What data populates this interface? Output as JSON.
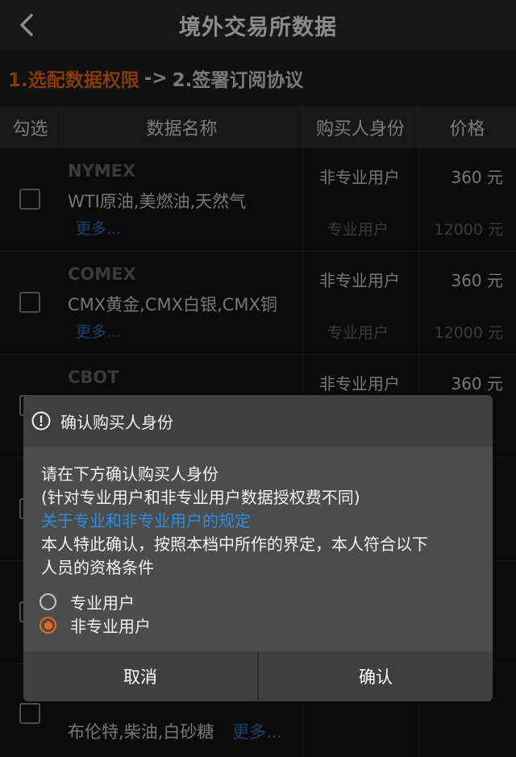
{
  "navbar": {
    "back_icon": "chevron-left-icon",
    "title": "境外交易所数据"
  },
  "steps": {
    "step1": "1.选配数据权限",
    "separator": "->",
    "step2": "2.签署订阅协议"
  },
  "table": {
    "headers": [
      "勾选",
      "数据名称",
      "购买人身份",
      "价格"
    ],
    "rows": [
      {
        "exchange": "NYMEX",
        "desc": "WTI原油,美燃油,天然气",
        "more": "更多...",
        "id1": "非专业用户",
        "price1": "360 元",
        "id2": "专业用户",
        "price2": "12000 元"
      },
      {
        "exchange": "COMEX",
        "desc": "CMX黄金,CMX白银,CMX铜",
        "more": "更多...",
        "id1": "非专业用户",
        "price1": "360 元",
        "id2": "专业用户",
        "price2": "12000 元"
      },
      {
        "exchange": "CBOT",
        "desc": "",
        "more": "",
        "id1": "非专业用户",
        "price1": "360 元",
        "id2": "",
        "price2": ""
      }
    ],
    "bottom_row": {
      "desc": "布伦特,柴油,白砂糖",
      "more": "更多..."
    }
  },
  "dialog": {
    "icon": "exclamation-circle-icon",
    "title": "确认购买人身份",
    "line1": "请在下方确认购买人身份",
    "line2": "(针对专业用户和非专业用户数据授权费不同)",
    "link": "关于专业和非专业用户的规定",
    "line3": "本人特此确认，按照本档中所作的界定，本人符合以下",
    "line4": "人员的资格条件",
    "options": [
      {
        "label": "专业用户",
        "selected": false
      },
      {
        "label": "非专业用户",
        "selected": true
      }
    ],
    "cancel": "取消",
    "confirm": "确认"
  },
  "colors": {
    "accent": "#f06a16",
    "link": "#2d8be0"
  }
}
